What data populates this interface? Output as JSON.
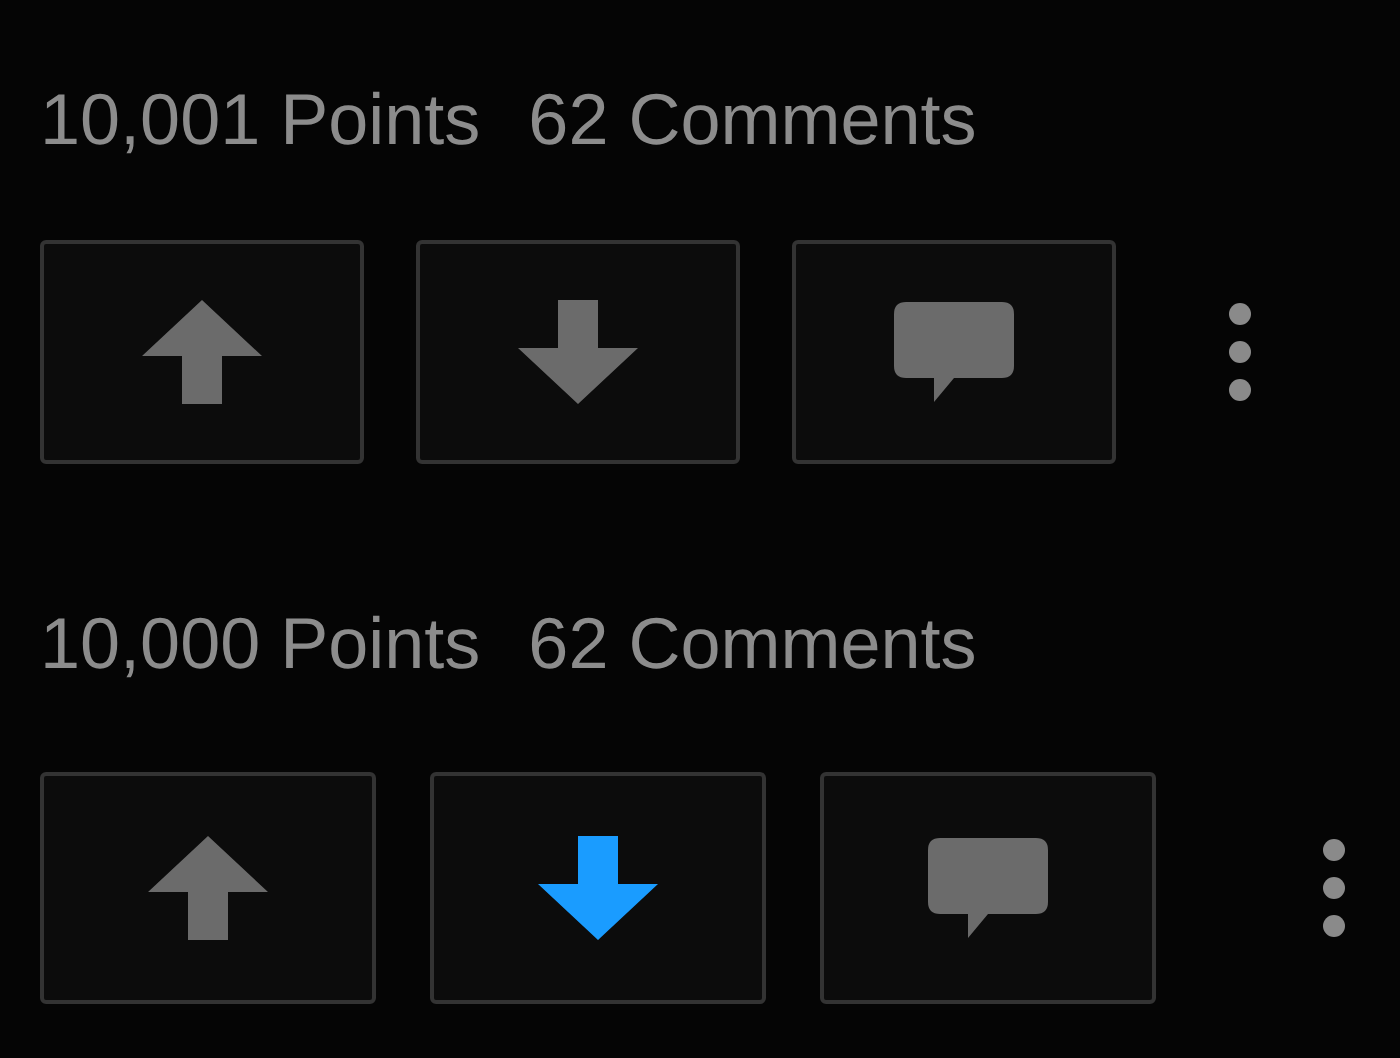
{
  "posts": [
    {
      "points": "10,001 Points",
      "comments": "62 Comments",
      "upvote": {
        "selected": false
      },
      "downvote": {
        "selected": false
      }
    },
    {
      "points": "10,000 Points",
      "comments": "62 Comments",
      "upvote": {
        "selected": false
      },
      "downvote": {
        "selected": true
      }
    }
  ]
}
